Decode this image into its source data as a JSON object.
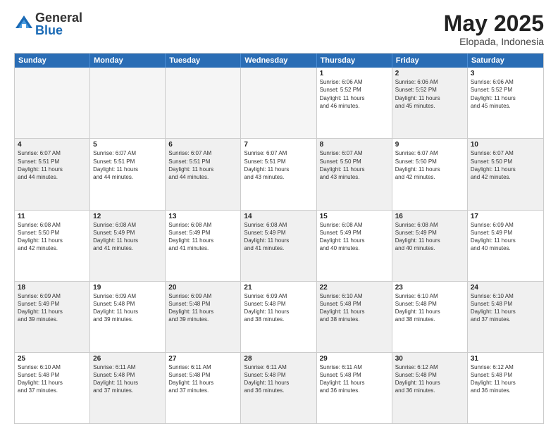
{
  "logo": {
    "general": "General",
    "blue": "Blue"
  },
  "title": "May 2025",
  "subtitle": "Elopada, Indonesia",
  "header_days": [
    "Sunday",
    "Monday",
    "Tuesday",
    "Wednesday",
    "Thursday",
    "Friday",
    "Saturday"
  ],
  "weeks": [
    [
      {
        "day": "",
        "info": "",
        "shaded": true
      },
      {
        "day": "",
        "info": "",
        "shaded": true
      },
      {
        "day": "",
        "info": "",
        "shaded": true
      },
      {
        "day": "",
        "info": "",
        "shaded": true
      },
      {
        "day": "1",
        "info": "Sunrise: 6:06 AM\nSunset: 5:52 PM\nDaylight: 11 hours\nand 46 minutes."
      },
      {
        "day": "2",
        "info": "Sunrise: 6:06 AM\nSunset: 5:52 PM\nDaylight: 11 hours\nand 45 minutes.",
        "shaded": true
      },
      {
        "day": "3",
        "info": "Sunrise: 6:06 AM\nSunset: 5:52 PM\nDaylight: 11 hours\nand 45 minutes."
      }
    ],
    [
      {
        "day": "4",
        "info": "Sunrise: 6:07 AM\nSunset: 5:51 PM\nDaylight: 11 hours\nand 44 minutes.",
        "shaded": true
      },
      {
        "day": "5",
        "info": "Sunrise: 6:07 AM\nSunset: 5:51 PM\nDaylight: 11 hours\nand 44 minutes."
      },
      {
        "day": "6",
        "info": "Sunrise: 6:07 AM\nSunset: 5:51 PM\nDaylight: 11 hours\nand 44 minutes.",
        "shaded": true
      },
      {
        "day": "7",
        "info": "Sunrise: 6:07 AM\nSunset: 5:51 PM\nDaylight: 11 hours\nand 43 minutes."
      },
      {
        "day": "8",
        "info": "Sunrise: 6:07 AM\nSunset: 5:50 PM\nDaylight: 11 hours\nand 43 minutes.",
        "shaded": true
      },
      {
        "day": "9",
        "info": "Sunrise: 6:07 AM\nSunset: 5:50 PM\nDaylight: 11 hours\nand 42 minutes."
      },
      {
        "day": "10",
        "info": "Sunrise: 6:07 AM\nSunset: 5:50 PM\nDaylight: 11 hours\nand 42 minutes.",
        "shaded": true
      }
    ],
    [
      {
        "day": "11",
        "info": "Sunrise: 6:08 AM\nSunset: 5:50 PM\nDaylight: 11 hours\nand 42 minutes."
      },
      {
        "day": "12",
        "info": "Sunrise: 6:08 AM\nSunset: 5:49 PM\nDaylight: 11 hours\nand 41 minutes.",
        "shaded": true
      },
      {
        "day": "13",
        "info": "Sunrise: 6:08 AM\nSunset: 5:49 PM\nDaylight: 11 hours\nand 41 minutes."
      },
      {
        "day": "14",
        "info": "Sunrise: 6:08 AM\nSunset: 5:49 PM\nDaylight: 11 hours\nand 41 minutes.",
        "shaded": true
      },
      {
        "day": "15",
        "info": "Sunrise: 6:08 AM\nSunset: 5:49 PM\nDaylight: 11 hours\nand 40 minutes."
      },
      {
        "day": "16",
        "info": "Sunrise: 6:08 AM\nSunset: 5:49 PM\nDaylight: 11 hours\nand 40 minutes.",
        "shaded": true
      },
      {
        "day": "17",
        "info": "Sunrise: 6:09 AM\nSunset: 5:49 PM\nDaylight: 11 hours\nand 40 minutes."
      }
    ],
    [
      {
        "day": "18",
        "info": "Sunrise: 6:09 AM\nSunset: 5:49 PM\nDaylight: 11 hours\nand 39 minutes.",
        "shaded": true
      },
      {
        "day": "19",
        "info": "Sunrise: 6:09 AM\nSunset: 5:48 PM\nDaylight: 11 hours\nand 39 minutes."
      },
      {
        "day": "20",
        "info": "Sunrise: 6:09 AM\nSunset: 5:48 PM\nDaylight: 11 hours\nand 39 minutes.",
        "shaded": true
      },
      {
        "day": "21",
        "info": "Sunrise: 6:09 AM\nSunset: 5:48 PM\nDaylight: 11 hours\nand 38 minutes."
      },
      {
        "day": "22",
        "info": "Sunrise: 6:10 AM\nSunset: 5:48 PM\nDaylight: 11 hours\nand 38 minutes.",
        "shaded": true
      },
      {
        "day": "23",
        "info": "Sunrise: 6:10 AM\nSunset: 5:48 PM\nDaylight: 11 hours\nand 38 minutes."
      },
      {
        "day": "24",
        "info": "Sunrise: 6:10 AM\nSunset: 5:48 PM\nDaylight: 11 hours\nand 37 minutes.",
        "shaded": true
      }
    ],
    [
      {
        "day": "25",
        "info": "Sunrise: 6:10 AM\nSunset: 5:48 PM\nDaylight: 11 hours\nand 37 minutes."
      },
      {
        "day": "26",
        "info": "Sunrise: 6:11 AM\nSunset: 5:48 PM\nDaylight: 11 hours\nand 37 minutes.",
        "shaded": true
      },
      {
        "day": "27",
        "info": "Sunrise: 6:11 AM\nSunset: 5:48 PM\nDaylight: 11 hours\nand 37 minutes."
      },
      {
        "day": "28",
        "info": "Sunrise: 6:11 AM\nSunset: 5:48 PM\nDaylight: 11 hours\nand 36 minutes.",
        "shaded": true
      },
      {
        "day": "29",
        "info": "Sunrise: 6:11 AM\nSunset: 5:48 PM\nDaylight: 11 hours\nand 36 minutes."
      },
      {
        "day": "30",
        "info": "Sunrise: 6:12 AM\nSunset: 5:48 PM\nDaylight: 11 hours\nand 36 minutes.",
        "shaded": true
      },
      {
        "day": "31",
        "info": "Sunrise: 6:12 AM\nSunset: 5:48 PM\nDaylight: 11 hours\nand 36 minutes."
      }
    ]
  ]
}
